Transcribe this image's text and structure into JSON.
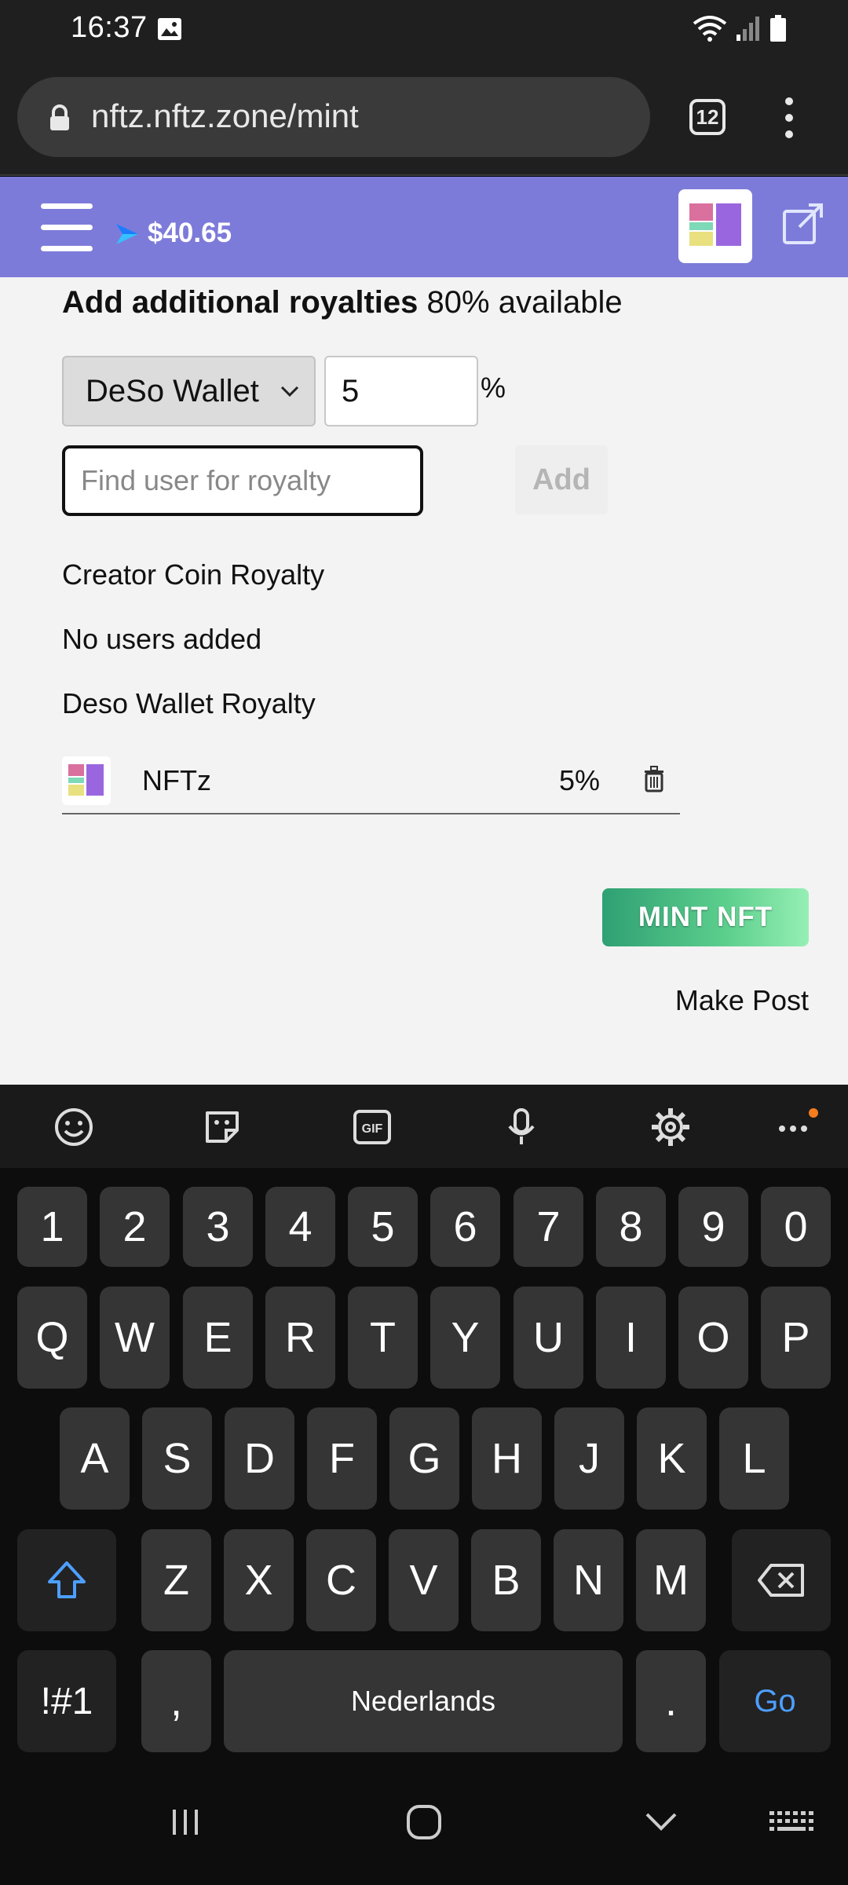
{
  "status_bar": {
    "time": "16:37"
  },
  "browser": {
    "url": "nftz.nftz.zone/mint",
    "tab_count": "12"
  },
  "app_header": {
    "balance": "$40.65"
  },
  "royalties": {
    "heading_bold": "Add additional royalties",
    "heading_available": "80% available",
    "wallet_select": "DeSo Wallet",
    "percent_value": "5",
    "percent_symbol": "%",
    "find_user_placeholder": "Find user for royalty",
    "add_label": "Add",
    "creator_coin_label": "Creator Coin Royalty",
    "no_users_label": "No users added",
    "deso_wallet_label": "Deso Wallet Royalty",
    "rows": [
      {
        "name": "NFTz",
        "percent": "5%"
      }
    ]
  },
  "actions": {
    "mint_label": "MINT NFT",
    "make_post_label": "Make Post"
  },
  "keyboard": {
    "numbers": [
      "1",
      "2",
      "3",
      "4",
      "5",
      "6",
      "7",
      "8",
      "9",
      "0"
    ],
    "row1": [
      "Q",
      "W",
      "E",
      "R",
      "T",
      "Y",
      "U",
      "I",
      "O",
      "P"
    ],
    "row2": [
      "A",
      "S",
      "D",
      "F",
      "G",
      "H",
      "J",
      "K",
      "L"
    ],
    "row3": [
      "Z",
      "X",
      "C",
      "V",
      "B",
      "N",
      "M"
    ],
    "symbols_label": "!#1",
    "comma": ",",
    "space_label": "Nederlands",
    "period": ".",
    "go_label": "Go"
  },
  "colors": {
    "header": "#7d7bd9",
    "mint_start": "#2fa073",
    "mint_end": "#96efb5",
    "go_blue": "#4d9fff"
  }
}
